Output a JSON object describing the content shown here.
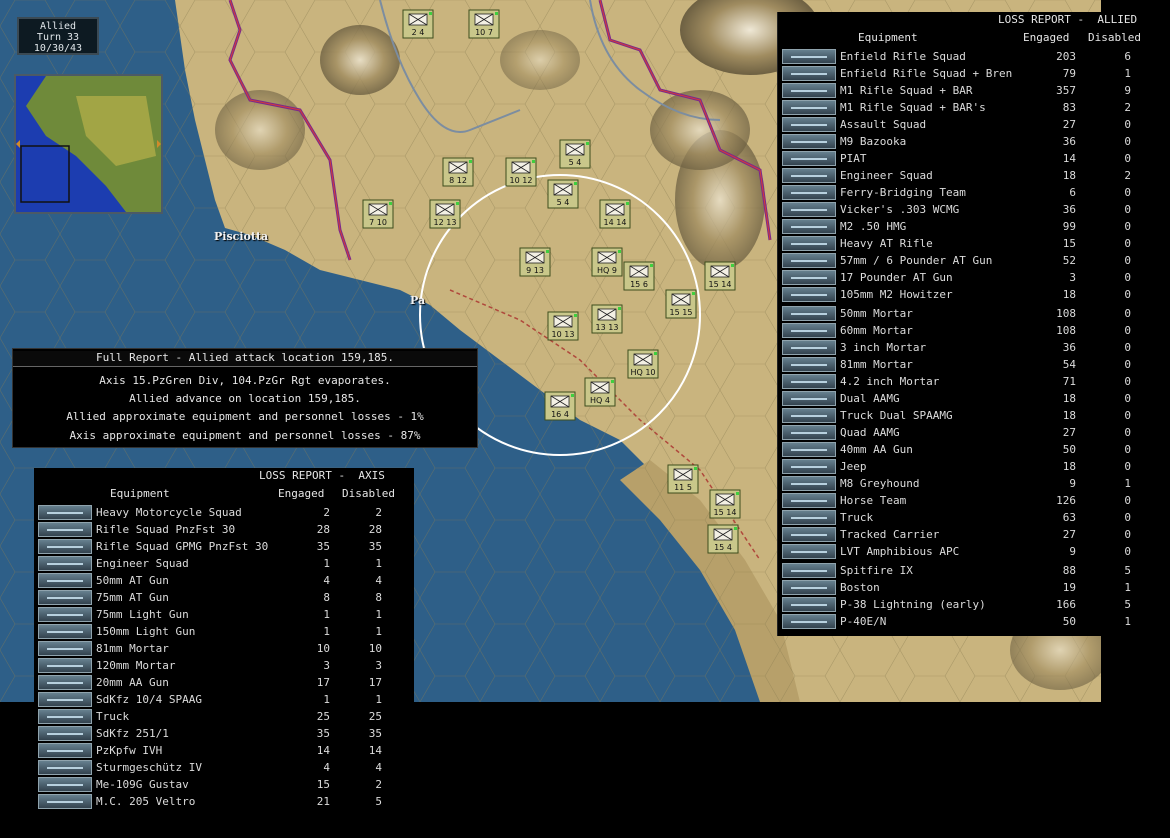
{
  "turn": {
    "side": "Allied",
    "turn": "Turn 33",
    "date": "10/30/43"
  },
  "places": {
    "town": "Pisciotta",
    "partial": "Pa"
  },
  "full_report": {
    "title": "Full Report -  Allied attack location 159,185.",
    "lines": [
      "Axis 15.PzGren Div, 104.PzGr Rgt evaporates.",
      "Allied advance on location 159,185.",
      "Allied approximate equipment and personnel losses - 1%",
      "Axis approximate equipment and personnel losses - 87%"
    ]
  },
  "allied_report": {
    "title": "LOSS REPORT -  ALLIED",
    "col_equipment": "Equipment",
    "col_engaged": "Engaged",
    "col_disabled": "Disabled",
    "rows": [
      {
        "name": "Enfield Rifle Squad",
        "engaged": "203",
        "disabled": "6"
      },
      {
        "name": "Enfield Rifle Squad + Bren",
        "engaged": "79",
        "disabled": "1"
      },
      {
        "name": "M1 Rifle Squad + BAR",
        "engaged": "357",
        "disabled": "9"
      },
      {
        "name": "M1 Rifle Squad + BAR's",
        "engaged": "83",
        "disabled": "2"
      },
      {
        "name": "Assault Squad",
        "engaged": "27",
        "disabled": "0"
      },
      {
        "name": "M9 Bazooka",
        "engaged": "36",
        "disabled": "0"
      },
      {
        "name": "PIAT",
        "engaged": "14",
        "disabled": "0"
      },
      {
        "name": "Engineer Squad",
        "engaged": "18",
        "disabled": "2"
      },
      {
        "name": "Ferry-Bridging Team",
        "engaged": "6",
        "disabled": "0"
      },
      {
        "name": "Vicker's .303 WCMG",
        "engaged": "36",
        "disabled": "0"
      },
      {
        "name": "M2 .50 HMG",
        "engaged": "99",
        "disabled": "0"
      },
      {
        "name": "Heavy AT Rifle",
        "engaged": "15",
        "disabled": "0"
      },
      {
        "name": "57mm / 6 Pounder AT Gun",
        "engaged": "52",
        "disabled": "0"
      },
      {
        "name": "17 Pounder AT Gun",
        "engaged": "3",
        "disabled": "0"
      },
      {
        "name": "105mm M2 Howitzer",
        "engaged": "18",
        "disabled": "0"
      },
      {
        "name": "50mm Mortar",
        "engaged": "108",
        "disabled": "0"
      },
      {
        "name": "60mm Mortar",
        "engaged": "108",
        "disabled": "0"
      },
      {
        "name": "3 inch Mortar",
        "engaged": "36",
        "disabled": "0"
      },
      {
        "name": "81mm Mortar",
        "engaged": "54",
        "disabled": "0"
      },
      {
        "name": "4.2 inch Mortar",
        "engaged": "71",
        "disabled": "0"
      },
      {
        "name": "Dual AAMG",
        "engaged": "18",
        "disabled": "0"
      },
      {
        "name": "Truck Dual SPAAMG",
        "engaged": "18",
        "disabled": "0"
      },
      {
        "name": "Quad AAMG",
        "engaged": "27",
        "disabled": "0"
      },
      {
        "name": "40mm AA Gun",
        "engaged": "50",
        "disabled": "0"
      },
      {
        "name": "Jeep",
        "engaged": "18",
        "disabled": "0"
      },
      {
        "name": "M8 Greyhound",
        "engaged": "9",
        "disabled": "1"
      },
      {
        "name": "Horse Team",
        "engaged": "126",
        "disabled": "0"
      },
      {
        "name": "Truck",
        "engaged": "63",
        "disabled": "0"
      },
      {
        "name": "Tracked Carrier",
        "engaged": "27",
        "disabled": "0"
      },
      {
        "name": "LVT Amphibious APC",
        "engaged": "9",
        "disabled": "0"
      },
      {
        "name": "Spitfire IX",
        "engaged": "88",
        "disabled": "5"
      },
      {
        "name": "Boston",
        "engaged": "19",
        "disabled": "1"
      },
      {
        "name": "P-38 Lightning (early)",
        "engaged": "166",
        "disabled": "5"
      },
      {
        "name": "P-40E/N",
        "engaged": "50",
        "disabled": "1"
      }
    ]
  },
  "axis_report": {
    "title": "LOSS REPORT -  AXIS",
    "col_equipment": "Equipment",
    "col_engaged": "Engaged",
    "col_disabled": "Disabled",
    "rows": [
      {
        "name": "Heavy Motorcycle Squad",
        "engaged": "2",
        "disabled": "2"
      },
      {
        "name": "Rifle Squad PnzFst 30",
        "engaged": "28",
        "disabled": "28"
      },
      {
        "name": "Rifle Squad GPMG PnzFst 30",
        "engaged": "35",
        "disabled": "35"
      },
      {
        "name": "Engineer Squad",
        "engaged": "1",
        "disabled": "1"
      },
      {
        "name": "50mm AT Gun",
        "engaged": "4",
        "disabled": "4"
      },
      {
        "name": "75mm AT Gun",
        "engaged": "8",
        "disabled": "8"
      },
      {
        "name": "75mm Light Gun",
        "engaged": "1",
        "disabled": "1"
      },
      {
        "name": "150mm Light Gun",
        "engaged": "1",
        "disabled": "1"
      },
      {
        "name": "81mm Mortar",
        "engaged": "10",
        "disabled": "10"
      },
      {
        "name": "120mm Mortar",
        "engaged": "3",
        "disabled": "3"
      },
      {
        "name": "20mm AA Gun",
        "engaged": "17",
        "disabled": "17"
      },
      {
        "name": "SdKfz 10/4 SPAAG",
        "engaged": "1",
        "disabled": "1"
      },
      {
        "name": "Truck",
        "engaged": "25",
        "disabled": "25"
      },
      {
        "name": "SdKfz 251/1",
        "engaged": "35",
        "disabled": "35"
      },
      {
        "name": "PzKpfw IVH",
        "engaged": "14",
        "disabled": "14"
      },
      {
        "name": "Sturmgeschütz IV",
        "engaged": "4",
        "disabled": "4"
      },
      {
        "name": "Me-109G Gustav",
        "engaged": "15",
        "disabled": "2"
      },
      {
        "name": "M.C. 205 Veltro",
        "engaged": "21",
        "disabled": "5"
      }
    ]
  },
  "counters": [
    {
      "top": "2",
      "bot": "4",
      "side": "allied"
    },
    {
      "top": "10",
      "bot": "7",
      "side": "allied"
    },
    {
      "top": "5",
      "bot": "4",
      "side": "allied"
    },
    {
      "top": "8",
      "bot": "12",
      "side": "allied"
    },
    {
      "top": "10",
      "bot": "12",
      "side": "allied"
    },
    {
      "top": "5",
      "bot": "4",
      "side": "allied"
    },
    {
      "top": "7",
      "bot": "10",
      "side": "allied"
    },
    {
      "top": "12",
      "bot": "13",
      "side": "allied"
    },
    {
      "top": "9",
      "bot": "13",
      "side": "allied"
    },
    {
      "top": "14",
      "bot": "14",
      "side": "allied"
    },
    {
      "top": "HQ",
      "bot": "9",
      "side": "allied"
    },
    {
      "top": "15",
      "bot": "6",
      "side": "allied"
    },
    {
      "top": "15",
      "bot": "14",
      "side": "allied"
    },
    {
      "top": "10",
      "bot": "13",
      "side": "allied"
    },
    {
      "top": "13",
      "bot": "13",
      "side": "allied"
    },
    {
      "top": "15",
      "bot": "15",
      "side": "allied"
    },
    {
      "top": "HQ",
      "bot": "10",
      "side": "allied"
    },
    {
      "top": "HQ",
      "bot": "4",
      "side": "allied"
    },
    {
      "top": "16",
      "bot": "4",
      "side": "allied"
    },
    {
      "top": "11",
      "bot": "5",
      "side": "allied"
    },
    {
      "top": "15",
      "bot": "14",
      "side": "allied"
    },
    {
      "top": "15",
      "bot": "4",
      "side": "allied"
    }
  ]
}
